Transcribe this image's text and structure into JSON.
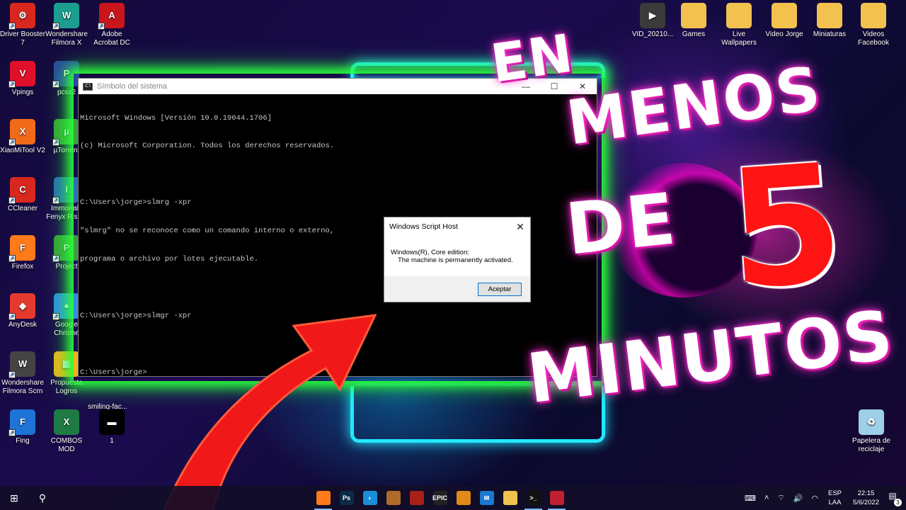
{
  "desktop_icons": [
    {
      "label": "Driver Booster 7",
      "symbol": "⚙",
      "color": "#d8281e",
      "shortcut": true
    },
    {
      "label": "Wondershare Filmora X",
      "symbol": "W",
      "color": "#1b9e8f",
      "shortcut": true
    },
    {
      "label": "Adobe Acrobat DC",
      "symbol": "A",
      "color": "#c9151c",
      "shortcut": true
    },
    {
      "label": "Vpings",
      "symbol": "V",
      "color": "#e0102a",
      "shortcut": true
    },
    {
      "label": "pcsx2",
      "symbol": "P",
      "color": "#2a4aa0",
      "shortcut": true
    },
    {
      "label": "XiaoMiTool V2",
      "symbol": "X",
      "color": "#f06a1a",
      "shortcut": true
    },
    {
      "label": "µTorrent",
      "symbol": "µ",
      "color": "#3aa33c",
      "shortcut": true
    },
    {
      "label": "CCleaner",
      "symbol": "C",
      "color": "#d8281e",
      "shortcut": true
    },
    {
      "label": "Immortals Fenyx Rising",
      "symbol": "I",
      "color": "#2a6fb0",
      "shortcut": true
    },
    {
      "label": "Firefox",
      "symbol": "F",
      "color": "#ff7a1a",
      "shortcut": true
    },
    {
      "label": "Project",
      "symbol": "P",
      "color": "#3a9e3c",
      "shortcut": true
    },
    {
      "label": "AnyDesk",
      "symbol": "◆",
      "color": "#e53a2e",
      "shortcut": true
    },
    {
      "label": "Google Chrome",
      "symbol": "●",
      "color": "#2f8ee0",
      "shortcut": true
    },
    {
      "label": "Wondershare Filmora Scrn",
      "symbol": "W",
      "color": "#444444",
      "shortcut": true
    },
    {
      "label": "Propuesta Logros",
      "symbol": "▦",
      "color": "#f2b01e",
      "shortcut": false
    },
    {
      "label": "smiling-fac...",
      "symbol": "",
      "color": "transparent",
      "shortcut": false
    },
    {
      "label": "Fing",
      "symbol": "F",
      "color": "#1e73d6",
      "shortcut": true
    },
    {
      "label": "COMBOS MOD",
      "symbol": "X",
      "color": "#1f7a43",
      "shortcut": false
    },
    {
      "label": "1",
      "symbol": "▬",
      "color": "#000000",
      "shortcut": false
    },
    {
      "label": "VID_20210...",
      "symbol": "▶",
      "color": "#3a3a3a",
      "shortcut": false
    },
    {
      "label": "Games",
      "symbol": "",
      "color": "#f2c14e",
      "shortcut": false
    },
    {
      "label": "Live Wallpapers",
      "symbol": "",
      "color": "#f2c14e",
      "shortcut": false
    },
    {
      "label": "Video Jorge",
      "symbol": "",
      "color": "#f2c14e",
      "shortcut": false
    },
    {
      "label": "Miniaturas",
      "symbol": "",
      "color": "#f2c14e",
      "shortcut": false
    },
    {
      "label": "Videos Facebook",
      "symbol": "",
      "color": "#f2c14e",
      "shortcut": false
    },
    {
      "label": "Papelera de reciclaje",
      "symbol": "♻",
      "color": "#9ecfe8",
      "shortcut": false
    }
  ],
  "cmd": {
    "title": "Símbolo del sistema",
    "minimize": "—",
    "maximize": "☐",
    "close": "✕",
    "lines": [
      "Microsoft Windows [Versión 10.0.19044.1706]",
      "(c) Microsoft Corporation. Todos los derechos reservados.",
      "",
      "C:\\Users\\jorge>slmrg -xpr",
      "\"slmrg\" no se reconoce como un comando interno o externo,",
      "programa o archivo por lotes ejecutable.",
      "",
      "C:\\Users\\jorge>slmgr -xpr",
      "",
      "C:\\Users\\jorge>"
    ]
  },
  "dialog": {
    "title": "Windows Script Host",
    "close": "✕",
    "line1": "Windows(R), Core edition:",
    "line2": "The machine is permanently activated.",
    "button": "Aceptar"
  },
  "overlay": {
    "word1": "EN",
    "word2": "MENOS",
    "word3": "DE",
    "number": "5",
    "word4": "MINUTOS"
  },
  "taskbar": {
    "start": "⊞",
    "search": "⚲",
    "apps": [
      {
        "name": "firefox",
        "label": "",
        "color": "#ff7a1a",
        "active": true
      },
      {
        "name": "photoshop",
        "label": "Ps",
        "color": "#0a2a48",
        "active": false
      },
      {
        "name": "dolphin",
        "label": "◗",
        "color": "#1a8fd8",
        "active": false
      },
      {
        "name": "game1",
        "label": "",
        "color": "#b06a2a",
        "active": false
      },
      {
        "name": "game2",
        "label": "",
        "color": "#a82018",
        "active": false
      },
      {
        "name": "epic",
        "label": "EPIC",
        "color": "#222222",
        "active": false
      },
      {
        "name": "game3",
        "label": "",
        "color": "#e08a1a",
        "active": false
      },
      {
        "name": "mail",
        "label": "✉",
        "color": "#1a78d0",
        "active": false
      },
      {
        "name": "explorer",
        "label": "",
        "color": "#f2c14e",
        "active": false
      },
      {
        "name": "cmd",
        "label": ">_",
        "color": "#111111",
        "active": true
      },
      {
        "name": "app",
        "label": "",
        "color": "#c02030",
        "active": true
      }
    ],
    "lang": "ESP",
    "lang2": "LAA",
    "time": "22:15",
    "date": "5/6/2022",
    "notifications": "3"
  }
}
